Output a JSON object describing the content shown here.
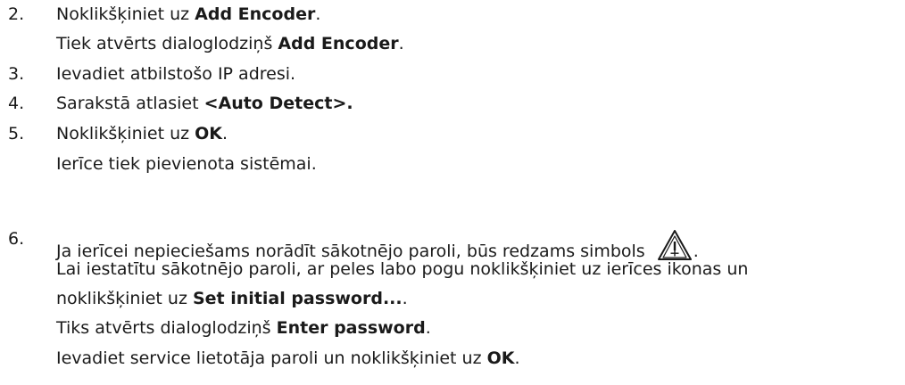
{
  "steps": [
    {
      "number": "2.",
      "action": {
        "pre": "Noklikšķiniet uz ",
        "bold": "Add Encoder",
        "post": "."
      },
      "result": {
        "pre": "Tiek atvērts dialoglodziņš ",
        "bold": "Add Encoder",
        "post": "."
      }
    },
    {
      "number": "3.",
      "action": {
        "text": "Ievadiet atbilstošo IP adresi."
      }
    },
    {
      "number": "4.",
      "action": {
        "pre": "Sarakstā atlasiet ",
        "bold": "<Auto Detect>."
      }
    },
    {
      "number": "5.",
      "action": {
        "pre": "Noklikšķiniet uz ",
        "bold": "OK",
        "post": "."
      },
      "result": {
        "text": "Ierīce tiek pievienota sistēmai."
      }
    },
    {
      "number": "6.",
      "line1": {
        "pre": "Ja ierīcei nepieciešams norādīt sākotnējo paroli, būs redzams simbols ",
        "post": ".",
        "icon": "warning-triangle-icon"
      },
      "line2": {
        "text": "Lai iestatītu sākotnējo paroli, ar peles labo pogu noklikšķiniet uz ierīces ikonas un"
      },
      "line3": {
        "pre": "noklikšķiniet uz ",
        "bold": "Set initial password...",
        "post": "."
      },
      "line4": {
        "pre": "Tiks atvērts dialoglodziņš ",
        "bold": "Enter password",
        "post": "."
      },
      "line5": {
        "pre": "Ievadiet service lietotāja paroli un noklikšķiniet uz ",
        "bold": "OK",
        "post": "."
      }
    }
  ]
}
